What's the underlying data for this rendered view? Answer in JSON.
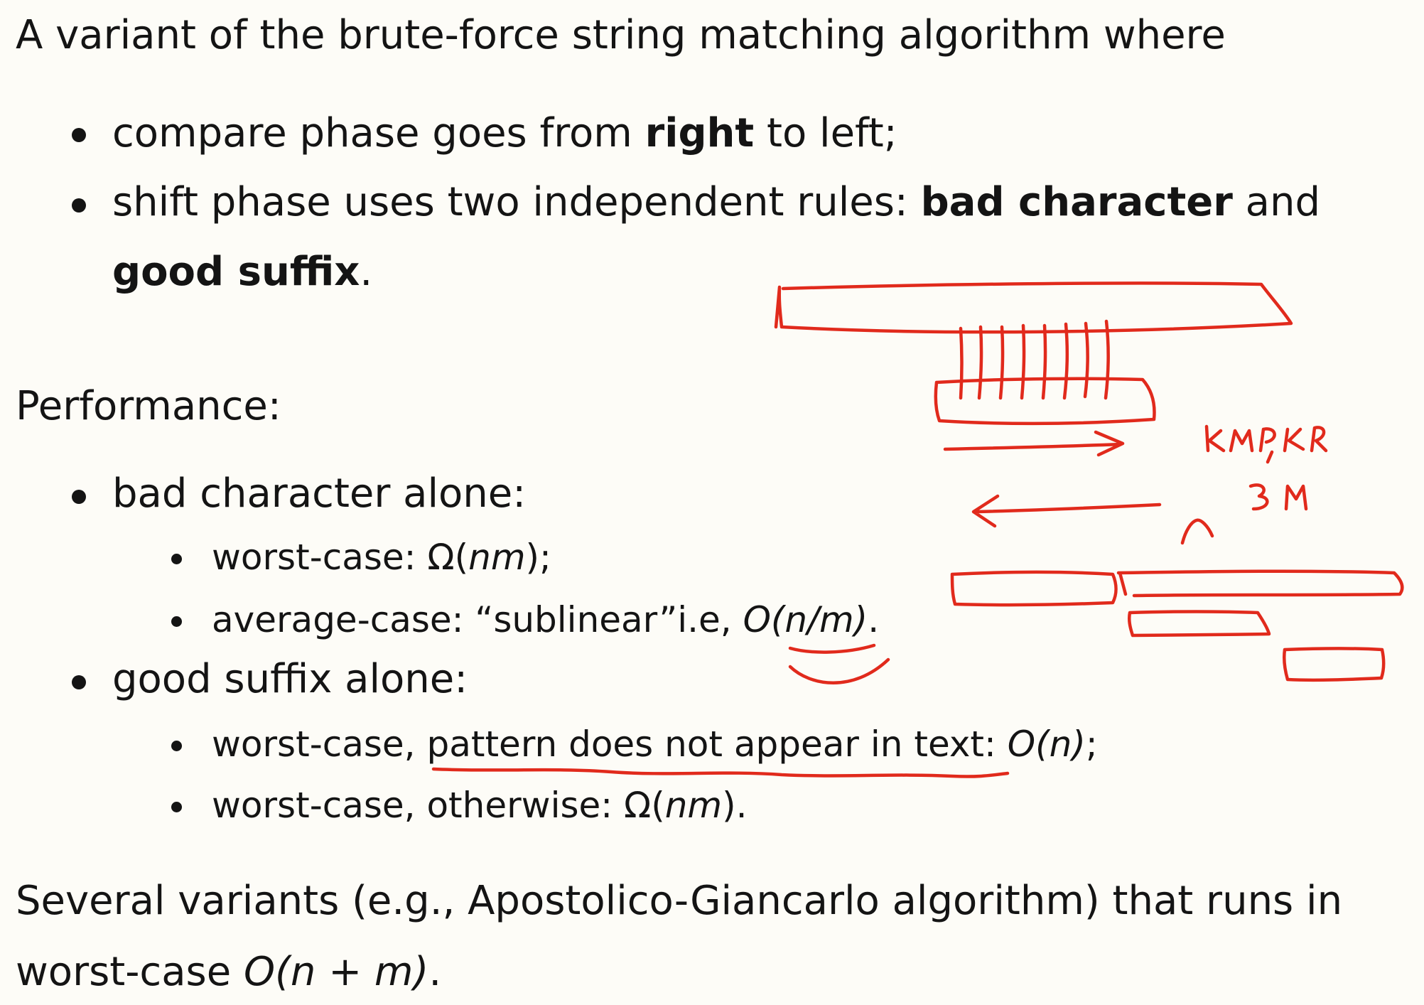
{
  "intro": {
    "text": "A variant of the brute-force string matching algorithm where"
  },
  "bullets_where": [
    {
      "pre": "compare phase goes from ",
      "bold": "right",
      "post": " to left;"
    },
    {
      "pre": "shift phase uses two independent rules: ",
      "bold1": "bad character",
      "mid": " and",
      "bold2": "good suffix",
      "post": "."
    }
  ],
  "performance": {
    "heading": "Performance:",
    "bad_character": {
      "label": "bad character alone:",
      "worst": {
        "pre": "worst-case: Ω(",
        "var": "nm",
        "post": ");"
      },
      "average": {
        "pre": "average-case: “sublinear”i.e, ",
        "big_o": "O",
        "arg": "(n/m)",
        "post": "."
      }
    },
    "good_suffix": {
      "label": "good suffix alone:",
      "worst_no_match": {
        "pre": "worst-case, ",
        "underlined": "pattern does not appear in text",
        "mid": ": ",
        "big_o": "O",
        "arg": "(n)",
        "post": ";"
      },
      "worst_otherwise": {
        "pre": "worst-case, otherwise: Ω(",
        "var": "nm",
        "post": ")."
      }
    }
  },
  "conclusion": {
    "line1": "Several variants (e.g., Apostolico-Giancarlo algorithm) that runs in",
    "line2_pre": "worst-case ",
    "big_o": "O",
    "arg": "(n + m)",
    "post": "."
  },
  "annotations": {
    "ink_color": "#e12a1c",
    "handwritten_1": "KMP, KR",
    "handwritten_2": "BM",
    "handwritten_3": "n"
  }
}
